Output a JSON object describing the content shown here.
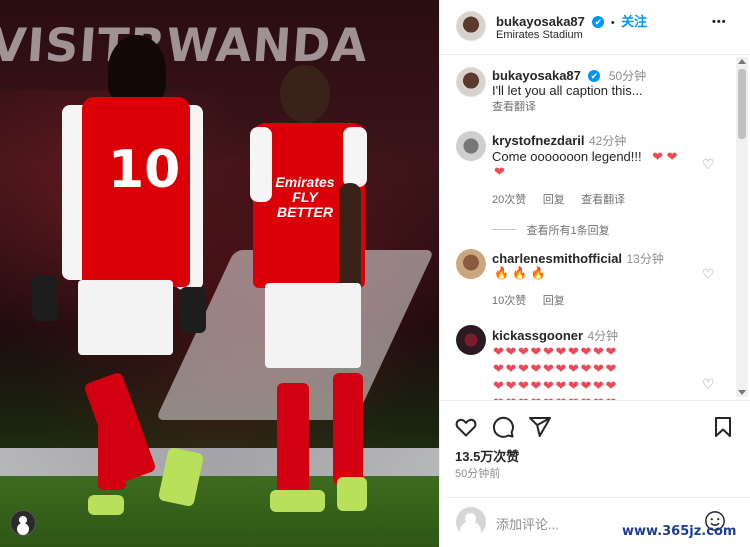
{
  "photo": {
    "banner_text": "VISITRWANDA",
    "player_number": "10",
    "sponsor": "Emirates FLY BETTER"
  },
  "header": {
    "username": "bukayosaka87",
    "verified": "✔",
    "separator": "•",
    "follow_label": "关注",
    "location": "Emirates Stadium",
    "more_icon": "•••"
  },
  "caption": {
    "username": "bukayosaka87",
    "time": "50分钟",
    "text": "I'll let you all caption this...",
    "translate": "查看翻译"
  },
  "comments": [
    {
      "username": "krystofnezdaril",
      "time": "42分钟",
      "text": "Come ooooooon legend!!!",
      "emoji": "❤ ❤",
      "emoji2": "❤",
      "likes": "20次赞",
      "reply": "回复",
      "translate": "查看翻译",
      "view_replies": "查看所有1条回复"
    },
    {
      "username": "charlenesmithofficial",
      "time": "13分钟",
      "emoji": "🔥 🔥 🔥",
      "likes": "10次赞",
      "reply": "回复"
    },
    {
      "username": "kickassgooner",
      "time": "4分钟",
      "hearts_rows": [
        "❤ ❤ ❤ ❤ ❤ ❤ ❤ ❤ ❤ ❤",
        "❤ ❤ ❤ ❤ ❤ ❤ ❤ ❤ ❤ ❤",
        "❤ ❤ ❤ ❤ ❤ ❤ ❤ ❤ ❤ ❤",
        "❤ ❤ ❤ ❤ ❤ ❤ ❤ ❤ ❤ ❤"
      ]
    }
  ],
  "actions": {
    "likes": "13.5万次赞",
    "posted": "50分钟前"
  },
  "add_comment": {
    "placeholder": "添加评论..."
  },
  "watermark": "www.365jz.com",
  "colors": {
    "accent": "#0095f6",
    "heart": "#ed4956",
    "arsenal_red": "#db0007"
  }
}
